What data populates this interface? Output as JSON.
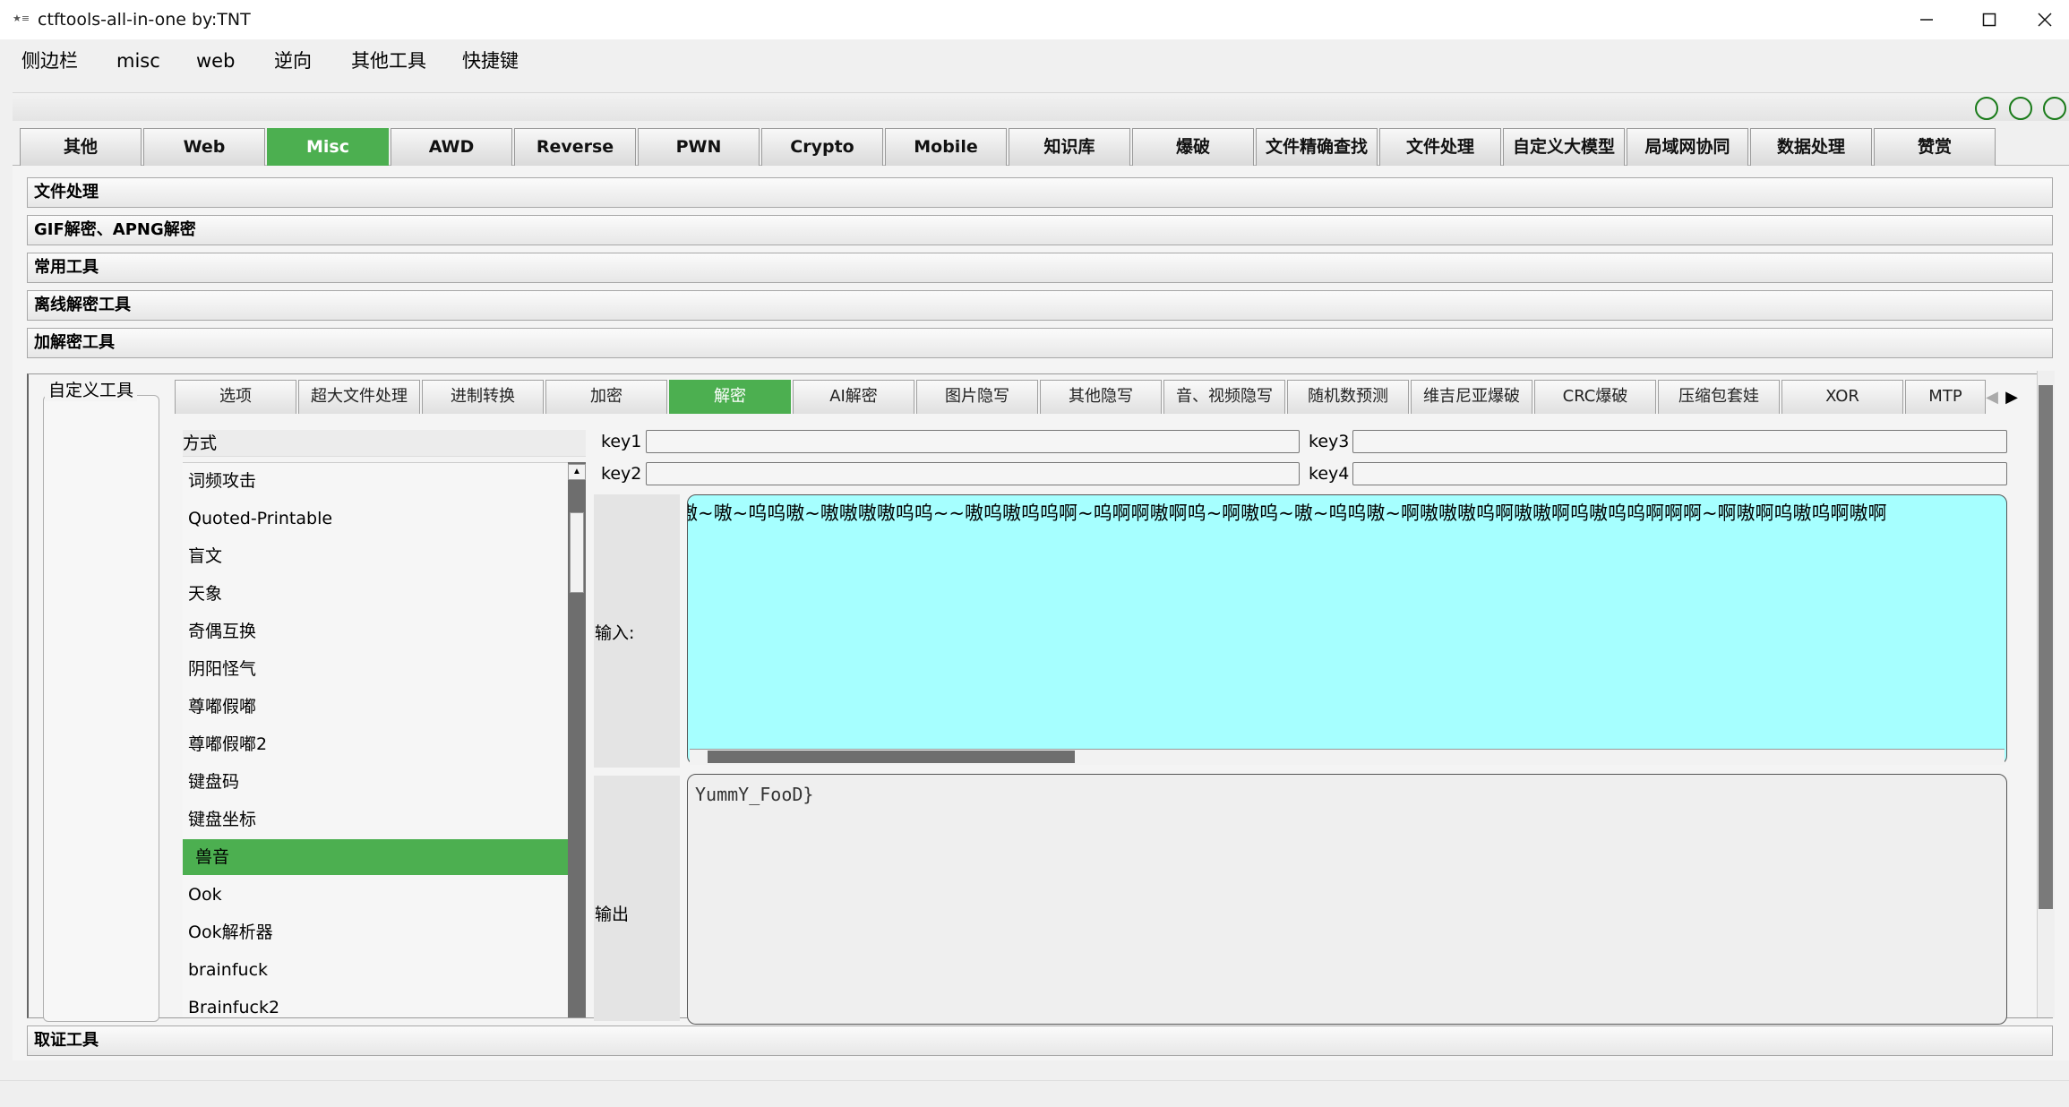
{
  "window": {
    "icon_glyph": "★≡",
    "title": "ctftools-all-in-one   by:TNT"
  },
  "menu": [
    {
      "label": "侧边栏"
    },
    {
      "label": "misc"
    },
    {
      "label": "web"
    },
    {
      "label": "逆向"
    },
    {
      "label": "其他工具"
    },
    {
      "label": "快捷键"
    }
  ],
  "main_tabs": [
    {
      "label": "其他"
    },
    {
      "label": "Web"
    },
    {
      "label": "Misc",
      "active": true
    },
    {
      "label": "AWD"
    },
    {
      "label": "Reverse"
    },
    {
      "label": "PWN"
    },
    {
      "label": "Crypto"
    },
    {
      "label": "Mobile"
    },
    {
      "label": "知识库"
    },
    {
      "label": "爆破"
    },
    {
      "label": "文件精确查找"
    },
    {
      "label": "文件处理"
    },
    {
      "label": "自定义大模型"
    },
    {
      "label": "局域网协同"
    },
    {
      "label": "数据处理"
    },
    {
      "label": "赞赏"
    }
  ],
  "accordion": [
    {
      "label": "文件处理"
    },
    {
      "label": "GIF解密、APNG解密"
    },
    {
      "label": "常用工具"
    },
    {
      "label": "离线解密工具"
    },
    {
      "label": "加解密工具"
    }
  ],
  "accordion_bottom": {
    "label": "取证工具"
  },
  "group": {
    "title": "自定义工具"
  },
  "sub_tabs": [
    {
      "label": "选项"
    },
    {
      "label": "超大文件处理"
    },
    {
      "label": "进制转换"
    },
    {
      "label": "加密"
    },
    {
      "label": "解密",
      "active": true
    },
    {
      "label": "AI解密"
    },
    {
      "label": "图片隐写"
    },
    {
      "label": "其他隐写"
    },
    {
      "label": "音、视频隐写"
    },
    {
      "label": "随机数预测"
    },
    {
      "label": "维吉尼亚爆破"
    },
    {
      "label": "CRC爆破"
    },
    {
      "label": "压缩包套娃"
    },
    {
      "label": "XOR"
    },
    {
      "label": "MTP"
    }
  ],
  "tab_arrows": {
    "left": "◀",
    "right": "▶"
  },
  "method": {
    "label": "方式",
    "items": [
      {
        "label": "词频攻击"
      },
      {
        "label": "Quoted-Printable"
      },
      {
        "label": "盲文"
      },
      {
        "label": "天象"
      },
      {
        "label": "奇偶互换"
      },
      {
        "label": "阴阳怪气"
      },
      {
        "label": "尊嘟假嘟"
      },
      {
        "label": "尊嘟假嘟2"
      },
      {
        "label": "键盘码"
      },
      {
        "label": "键盘坐标"
      },
      {
        "label": "兽音",
        "selected": true
      },
      {
        "label": "Ook"
      },
      {
        "label": "Ook解析器"
      },
      {
        "label": "brainfuck"
      },
      {
        "label": "Brainfuck2"
      }
    ],
    "scroll_up": "▲"
  },
  "keys": {
    "key1": {
      "label": "key1",
      "value": ""
    },
    "key2": {
      "label": "key2",
      "value": ""
    },
    "key3": {
      "label": "key3",
      "value": ""
    },
    "key4": {
      "label": "key4",
      "value": ""
    }
  },
  "io": {
    "input_label": "输入:",
    "input_value": "嗷~嗷~呜呜嗷~嗷嗷嗷嗷呜呜~~嗷呜嗷呜呜啊~呜啊啊嗷啊呜~啊嗷呜~嗷~呜呜嗷~啊嗷嗷嗷呜啊嗷嗷啊呜嗷呜呜啊啊啊~啊嗷啊呜嗷呜啊嗷啊",
    "output_label": "输出",
    "output_value": "YummY_FooD}"
  },
  "colors": {
    "accent_green": "#4caf50",
    "input_bg": "#a6ffff",
    "status_circle": "#1a7b1a"
  },
  "icons": {
    "minimize": "minimize-icon",
    "maximize": "maximize-icon",
    "close": "close-icon"
  }
}
